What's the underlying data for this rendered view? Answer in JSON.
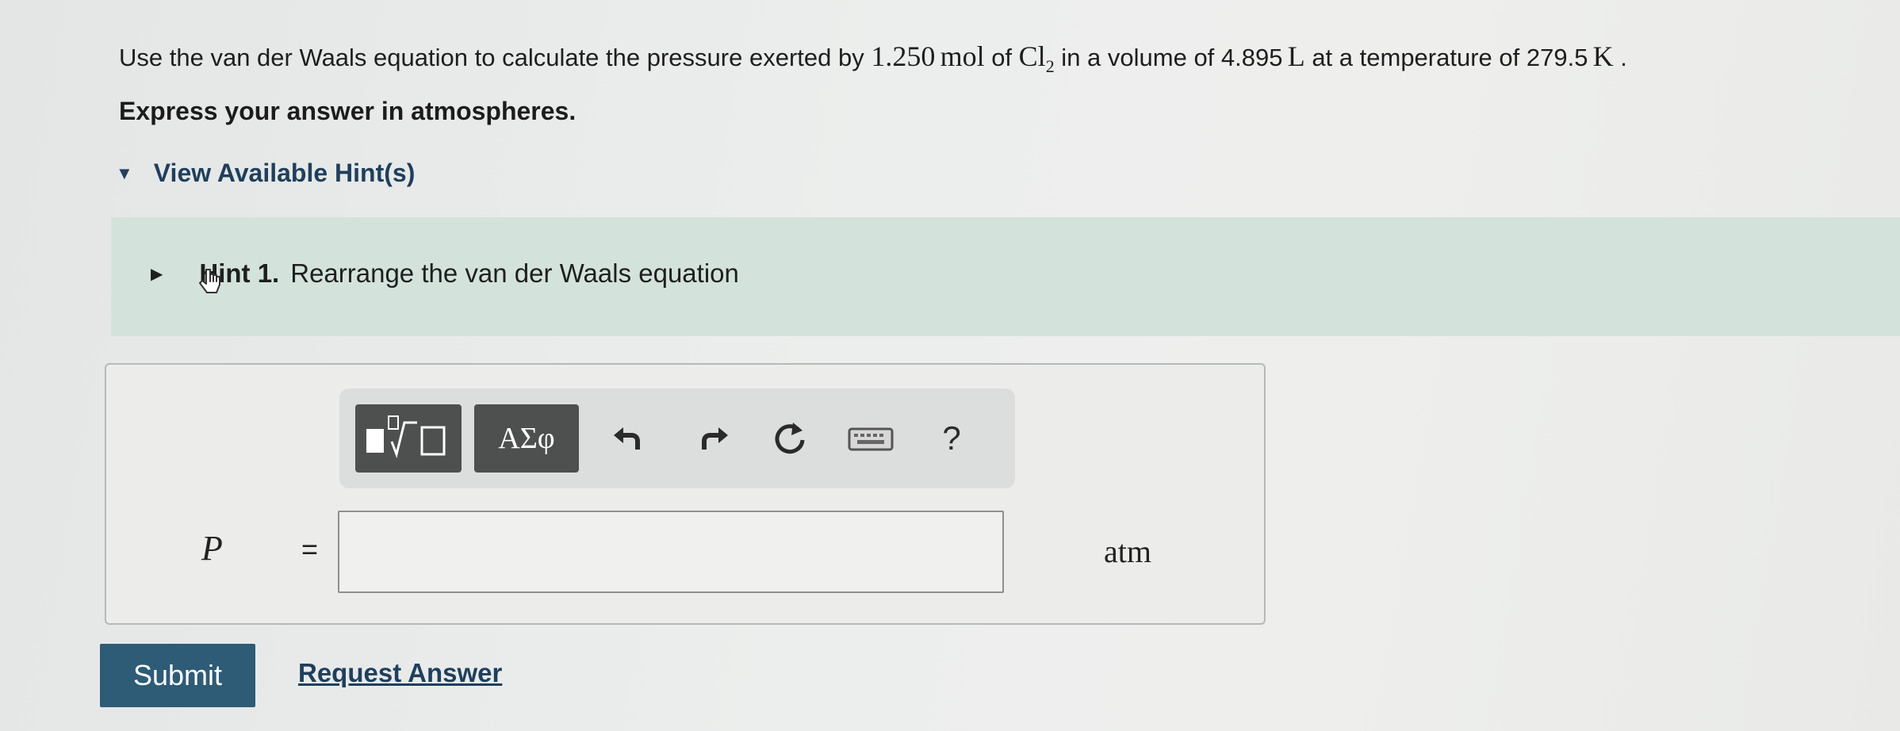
{
  "question": {
    "prefix": "Use the van der Waals equation to calculate the pressure exerted by ",
    "amount_value": "1.250",
    "amount_unit": "mol",
    "of": " of ",
    "species": "Cl",
    "species_sub": "2",
    "volume_text": " in a volume of ",
    "volume_value": "4.895",
    "volume_unit": "L",
    "temp_text": " at a temperature of ",
    "temp_value": "279.5",
    "temp_unit": "K",
    "end": " ."
  },
  "instruction": "Express your answer in atmospheres.",
  "hints": {
    "toggle_label": "View Available Hint(s)",
    "items": [
      {
        "label": "Hint 1.",
        "text": "Rearrange the van der Waals equation"
      }
    ]
  },
  "toolbar": {
    "templates_icon": "templates-icon",
    "greek_label": "ΑΣφ",
    "undo_icon": "undo-icon",
    "redo_icon": "redo-icon",
    "reset_icon": "reset-icon",
    "keyboard_icon": "keyboard-icon",
    "help_label": "?"
  },
  "answer": {
    "variable": "P",
    "equals": "=",
    "value": "",
    "unit": "atm"
  },
  "actions": {
    "submit_label": "Submit",
    "request_label": "Request Answer"
  },
  "colors": {
    "accent": "#2e5b76",
    "hint_panel": "#d3e3dc",
    "toolbar_dark": "#4e4f4f"
  }
}
